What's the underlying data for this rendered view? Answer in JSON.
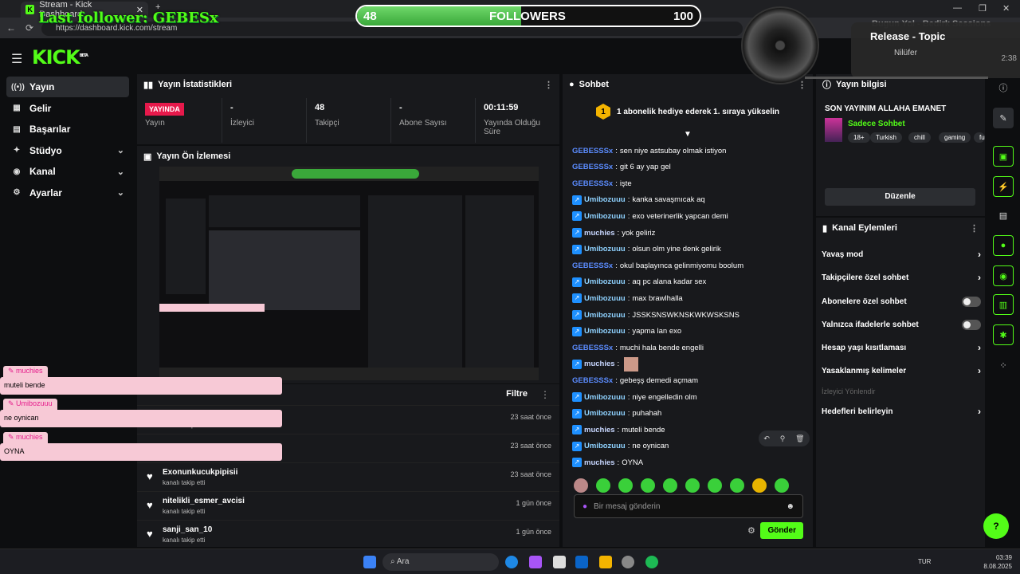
{
  "browser": {
    "tab_title": "Stream - Kick Dashboard",
    "new_tab": "+",
    "url": "https://dashboard.kick.com/stream",
    "back": "←",
    "reload": "⟳",
    "minimize": "—",
    "maximize": "❐",
    "close": "✕"
  },
  "overlay": {
    "last_follower": "Last follower: GEBESx",
    "followers_current": "48",
    "followers_label": "FOLLOWERS",
    "followers_goal": "100",
    "followers_progress": 0.48,
    "now_playing_title": "Release - Topic",
    "now_playing_artist": "Nilüfer",
    "bg_text": "Bugun Yol - Bedirk Sessions",
    "bg_num": "2:38"
  },
  "brand": {
    "name": "KICK",
    "beta": "BETA"
  },
  "sidebar": {
    "items": [
      {
        "label": "Yayın",
        "icon": "((•))"
      },
      {
        "label": "Gelir",
        "icon": "▦"
      },
      {
        "label": "Başarılar",
        "icon": "▤"
      },
      {
        "label": "Stüdyo",
        "icon": "✦",
        "chev": "⌄"
      },
      {
        "label": "Kanal",
        "icon": "◉",
        "chev": "⌄"
      },
      {
        "label": "Ayarlar",
        "icon": "⚙",
        "chev": "⌄"
      }
    ]
  },
  "stats": {
    "title": "Yayın İstatistikleri",
    "live": "YAYINDA",
    "cells": [
      {
        "value": "",
        "label": "Yayın"
      },
      {
        "value": "-",
        "label": "İzleyici"
      },
      {
        "value": "48",
        "label": "Takipçi"
      },
      {
        "value": "-",
        "label": "Abone Sayısı"
      },
      {
        "value": "00:11:59",
        "label": "Yayında Olduğu Süre"
      }
    ]
  },
  "preview": {
    "title": "Yayın Ön İzlemesi"
  },
  "follows": {
    "filter": "Filtre",
    "rows": [
      {
        "name": "",
        "sub": "kanalı takip etti",
        "time": "23 saat önce"
      },
      {
        "name": "",
        "sub": "",
        "time": "23 saat önce"
      },
      {
        "name": "Exonunkucukpipisii",
        "sub": "kanalı takip etti",
        "time": "23 saat önce"
      },
      {
        "name": "nitelikli_esmer_avcisi",
        "sub": "kanalı takip etti",
        "time": "1 gün önce"
      },
      {
        "name": "sanji_san_10",
        "sub": "kanalı takip etti",
        "time": "1 gün önce"
      }
    ]
  },
  "chat": {
    "title": "Sohbet",
    "pinned_number": "1",
    "pinned_text": "1 abonelik hediye ederek 1. sıraya yükselin",
    "messages": [
      {
        "user": "GEBESSSx",
        "text": "sen niye astsubay olmak istiyon",
        "cls": "u1",
        "badge": false
      },
      {
        "user": "GEBESSSx",
        "text": "git 6 ay yap gel",
        "cls": "u1",
        "badge": false
      },
      {
        "user": "GEBESSSx",
        "text": "işte",
        "cls": "u1",
        "badge": false
      },
      {
        "user": "Umibozuuu",
        "text": "kanka savaşmıcak aq",
        "cls": "u2",
        "badge": true
      },
      {
        "user": "Umibozuuu",
        "text": "exo veterinerlik yapcan demi",
        "cls": "u2",
        "badge": true
      },
      {
        "user": "muchies",
        "text": "yok geliriz",
        "cls": "u3",
        "badge": true
      },
      {
        "user": "Umibozuuu",
        "text": "olsun olm yine denk gelirik",
        "cls": "u2",
        "badge": true
      },
      {
        "user": "GEBESSSx",
        "text": "okul başlayınca gelinmiyomu boolum",
        "cls": "u1",
        "badge": false
      },
      {
        "user": "Umibozuuu",
        "text": "aq pc alana kadar sex",
        "cls": "u2",
        "badge": true
      },
      {
        "user": "Umibozuuu",
        "text": "max brawlhalla",
        "cls": "u2",
        "badge": true
      },
      {
        "user": "Umibozuuu",
        "text": "JSSKSNSWKNSKWKWSKSNS",
        "cls": "u2",
        "badge": true
      },
      {
        "user": "Umibozuuu",
        "text": "yapma lan exo",
        "cls": "u2",
        "badge": true
      },
      {
        "user": "GEBESSSx",
        "text": "muchi hala bende engelli",
        "cls": "u1",
        "badge": false
      },
      {
        "user": "muchies",
        "text": "",
        "cls": "u3",
        "badge": true
      },
      {
        "user": "GEBESSSx",
        "text": "gebeşş demedi açmam",
        "cls": "u1",
        "badge": false
      },
      {
        "user": "Umibozuuu",
        "text": "niye engelledin olm",
        "cls": "u2",
        "badge": true
      },
      {
        "user": "Umibozuuu",
        "text": "puhahah",
        "cls": "u2",
        "badge": true
      },
      {
        "user": "muchies",
        "text": "muteli bende",
        "cls": "u3",
        "badge": true
      },
      {
        "user": "Umibozuuu",
        "text": "ne oynican",
        "cls": "u2",
        "badge": true
      },
      {
        "user": "muchies",
        "text": "OYNA",
        "cls": "u3",
        "badge": true
      }
    ],
    "placeholder": "Bir mesaj gönderin",
    "send": "Gönder"
  },
  "info": {
    "title": "Yayın bilgisi",
    "stream_title": "SON YAYINIM ALLAHA EMANET",
    "category": "Sadece Sohbet",
    "tags": [
      "18+",
      "Turkish",
      "chill",
      "gaming",
      "fu"
    ],
    "edit": "Düzenle"
  },
  "actions": {
    "title": "Kanal Eylemleri",
    "rows": [
      {
        "label": "Yavaş mod",
        "type": "chev"
      },
      {
        "label": "Takipçilere özel sohbet",
        "type": "chev"
      },
      {
        "label": "Abonelere özel sohbet",
        "type": "toggle"
      },
      {
        "label": "Yalnızca ifadelerle sohbet",
        "type": "toggle"
      },
      {
        "label": "Hesap yaşı kısıtlaması",
        "type": "chev"
      },
      {
        "label": "Yasaklanmış kelimeler",
        "type": "chev"
      },
      {
        "label": "İzleyici Yönlendir",
        "type": "disabled"
      },
      {
        "label": "Hedefleri belirleyin",
        "type": "chev"
      }
    ]
  },
  "overlay_chat": [
    {
      "user": "muchies",
      "text": "muteli bende"
    },
    {
      "user": "Umibozuuu",
      "text": "ne oynican"
    },
    {
      "user": "muchies",
      "text": "OYNA"
    }
  ],
  "taskbar": {
    "search": "Ara",
    "lang": "TUR",
    "time": "03:39",
    "date": "8.08.2025"
  },
  "colors": {
    "accent": "#53fc18",
    "live": "#e6194b"
  }
}
